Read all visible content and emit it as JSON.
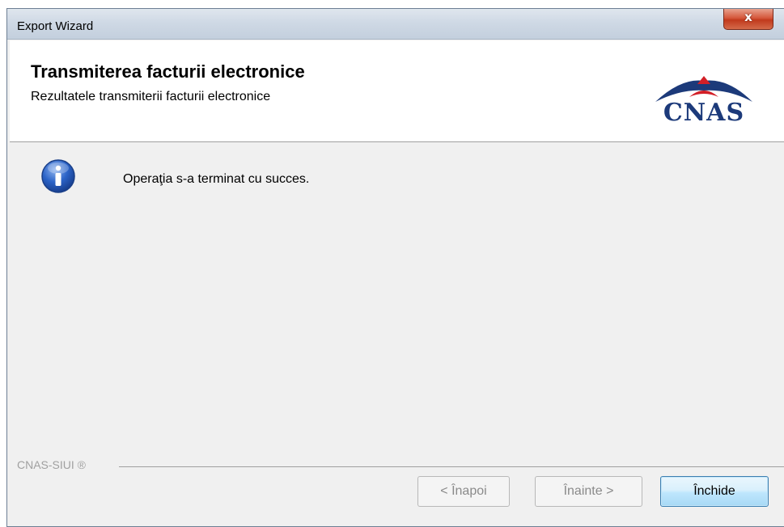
{
  "window": {
    "title": "Export Wizard",
    "close_glyph": "x"
  },
  "header": {
    "title": "Transmiterea facturii electronice",
    "subtitle": "Rezultatele transmiterii facturii electronice",
    "logo_text": "CNAS",
    "logo_color": "#1c3a7a",
    "logo_accent": "#d21f27"
  },
  "content": {
    "icon": "info-icon",
    "message": "Operaţia s-a terminat cu succes."
  },
  "footer": {
    "label": "CNAS-SIUI ®"
  },
  "buttons": {
    "back_label": "< Înapoi",
    "next_label": "Înainte >",
    "close_label": "Închide"
  }
}
